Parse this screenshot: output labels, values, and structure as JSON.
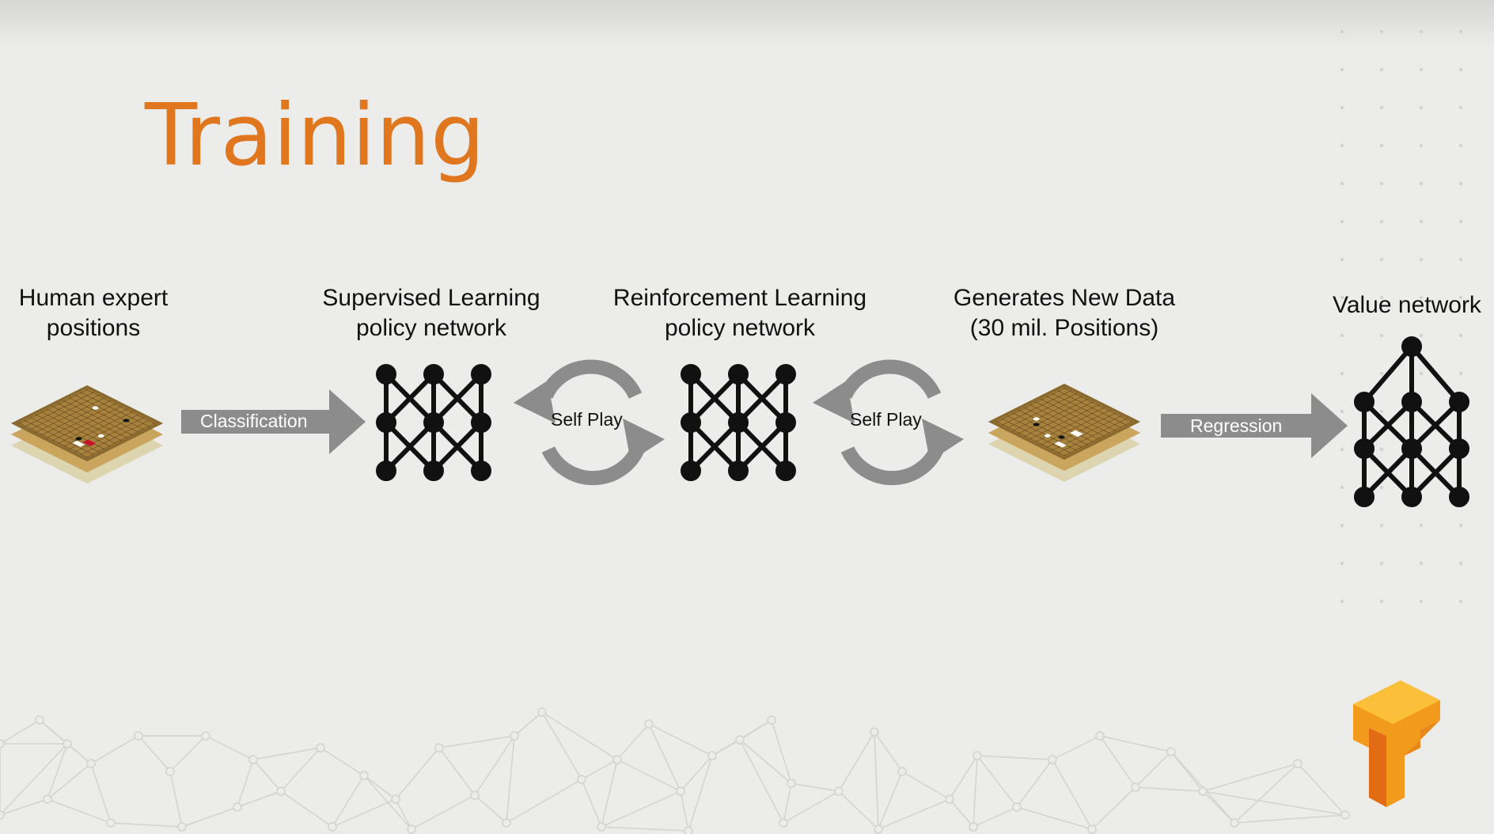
{
  "slide": {
    "title": "Training",
    "accent_color": "#e0761e"
  },
  "stages": [
    {
      "label_line1": "Human expert",
      "label_line2": "positions",
      "icon": "go-board-stack-icon"
    },
    {
      "label_line1": "Supervised Learning",
      "label_line2": "policy network",
      "icon": "neural-network-icon"
    },
    {
      "label_line1": "Reinforcement Learning",
      "label_line2": "policy network",
      "icon": "neural-network-icon"
    },
    {
      "label_line1": "Generates New Data",
      "label_line2": "(30 mil. Positions)",
      "icon": "go-board-stack-icon"
    },
    {
      "label_line1": "Value network",
      "icon": "value-network-icon"
    }
  ],
  "connectors": [
    {
      "type": "arrow",
      "label": "Classification"
    },
    {
      "type": "cycle",
      "label": "Self Play"
    },
    {
      "type": "cycle",
      "label": "Self Play"
    },
    {
      "type": "arrow",
      "label": "Regression"
    }
  ],
  "logo": {
    "icon": "tensorflow-logo-icon"
  }
}
